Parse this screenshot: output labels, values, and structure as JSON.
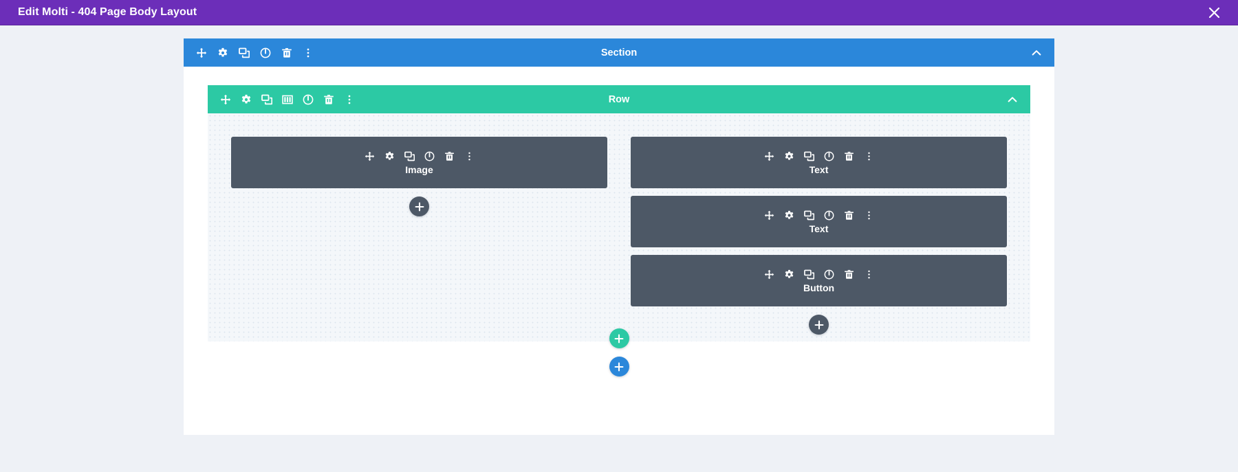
{
  "window": {
    "title": "Edit Molti - 404 Page Body Layout",
    "close_icon": "close-icon",
    "titlebar_color": "#6c2eb9"
  },
  "builder": {
    "section": {
      "label": "Section",
      "color": "#2b87da",
      "collapse_icon": "chevron-up-icon",
      "toolbar": [
        {
          "name": "move-icon",
          "title": "Move Section"
        },
        {
          "name": "gear-icon",
          "title": "Section Settings"
        },
        {
          "name": "duplicate-icon",
          "title": "Duplicate Section"
        },
        {
          "name": "power-icon",
          "title": "Disable Section"
        },
        {
          "name": "trash-icon",
          "title": "Delete Section"
        },
        {
          "name": "more-options-icon",
          "title": "More Options"
        }
      ]
    },
    "row": {
      "label": "Row",
      "color": "#2cc9a4",
      "collapse_icon": "chevron-up-icon",
      "toolbar": [
        {
          "name": "move-icon",
          "title": "Move Row"
        },
        {
          "name": "gear-icon",
          "title": "Row Settings"
        },
        {
          "name": "duplicate-icon",
          "title": "Duplicate Row"
        },
        {
          "name": "columns-icon",
          "title": "Change Column Structure"
        },
        {
          "name": "power-icon",
          "title": "Disable Row"
        },
        {
          "name": "trash-icon",
          "title": "Delete Row"
        },
        {
          "name": "more-options-icon",
          "title": "More Options"
        }
      ]
    },
    "module_toolbar": [
      {
        "name": "move-icon",
        "title": "Move Module"
      },
      {
        "name": "gear-icon",
        "title": "Module Settings"
      },
      {
        "name": "duplicate-icon",
        "title": "Duplicate Module"
      },
      {
        "name": "power-icon",
        "title": "Disable Module"
      },
      {
        "name": "trash-icon",
        "title": "Delete Module"
      },
      {
        "name": "more-options-icon",
        "title": "More Options"
      }
    ],
    "module_color": "#4d5866",
    "columns": [
      {
        "id": "left-column",
        "modules": [
          {
            "label": "Image"
          }
        ],
        "add_module_label": "+"
      },
      {
        "id": "right-column",
        "modules": [
          {
            "label": "Text"
          },
          {
            "label": "Text"
          },
          {
            "label": "Button"
          }
        ],
        "add_module_label": "+"
      }
    ],
    "add_row_label": "+",
    "add_section_label": "+"
  }
}
